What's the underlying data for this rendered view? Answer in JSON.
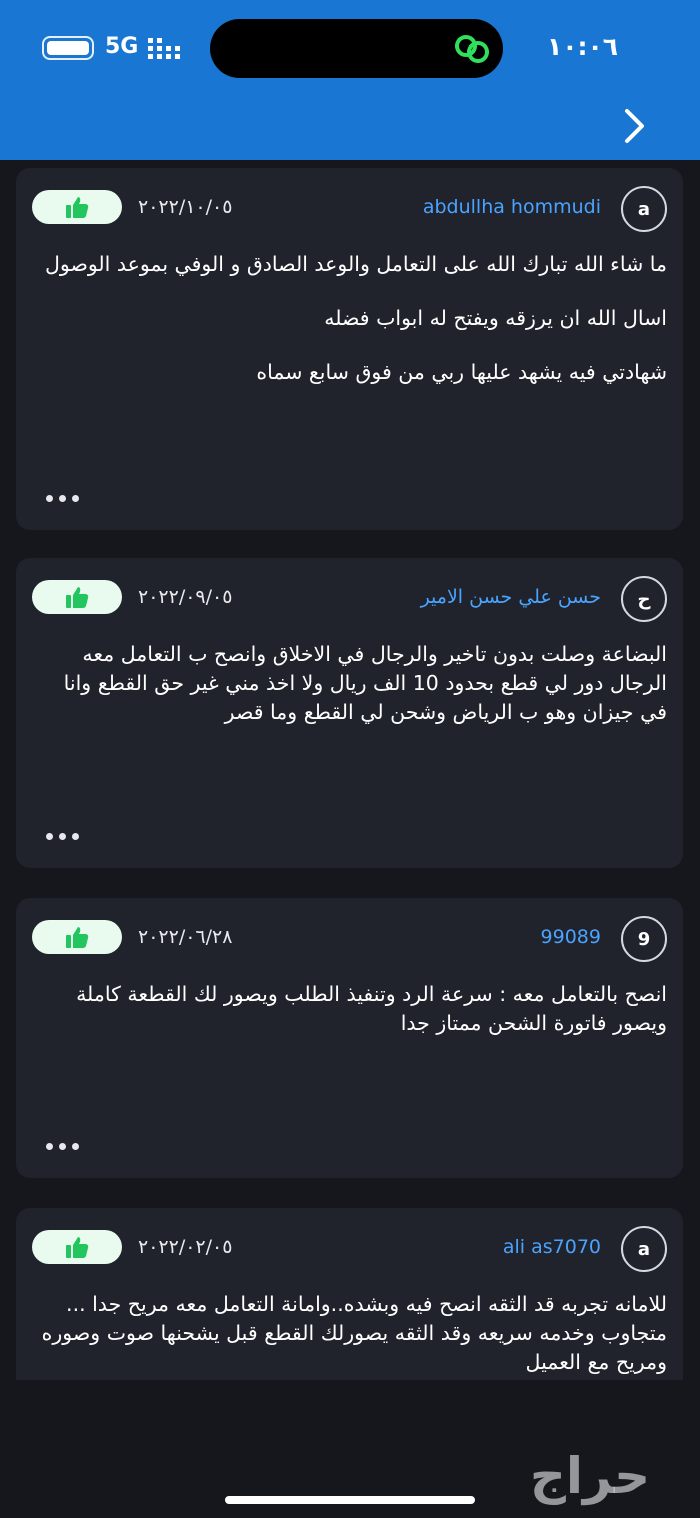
{
  "status_bar": {
    "time": "١٠:٠٦",
    "network": "5G"
  },
  "icons": {
    "forward": "chevron-right-icon",
    "like": "thumbs-up-icon",
    "more": "more-horizontal-icon",
    "link": "link-icon",
    "battery": "battery-icon",
    "signal": "signal-icon"
  },
  "colors": {
    "header": "#1976d2",
    "background": "#15171d",
    "card": "#20232c",
    "username": "#4aa3ff",
    "like_bg": "#e9fbee",
    "like_icon": "#22c55e"
  },
  "reviews": [
    {
      "avatar": "a",
      "username": "abdullha hommudi",
      "date": "٢٠٢٢/١٠/٠٥",
      "lines": [
        "ما شاء الله تبارك الله على التعامل والوعد الصادق و الوفي بموعد الوصول",
        "اسال الله ان يرزقه ويفتح له ابواب فضله",
        "شهادتي فيه يشهد عليها ربي من فوق سابع سماه"
      ]
    },
    {
      "avatar": "ح",
      "username": "حسن علي حسن الامير",
      "date": "٢٠٢٢/٠٩/٠٥",
      "lines": [
        "البضاعة وصلت بدون تاخير والرجال في الاخلاق وانصح ب التعامل معه الرجال دور لي قطع بحدود 10 الف ريال ولا اخذ مني غير حق القطع وانا في جيزان وهو ب الرياض وشحن لي القطع وما قصر"
      ]
    },
    {
      "avatar": "9",
      "username": "99089",
      "date": "٢٠٢٢/٠٦/٢٨",
      "lines": [
        "انصح بالتعامل معه : سرعة الرد وتنفيذ الطلب ويصور لك القطعة كاملة ويصور فاتورة الشحن ممتاز جدا"
      ]
    },
    {
      "avatar": "a",
      "username": "ali as7070",
      "date": "٢٠٢٢/٠٢/٠٥",
      "lines": [
        "للامانه تجربه قد الثقه انصح فيه وبشده..وامانة التعامل معه مريح جدا ... متجاوب وخدمه سريعه وقد الثقه يصورلك القطع قبل يشحنها صوت وصوره ومريح مع العميل"
      ]
    }
  ],
  "watermark": "حراج"
}
